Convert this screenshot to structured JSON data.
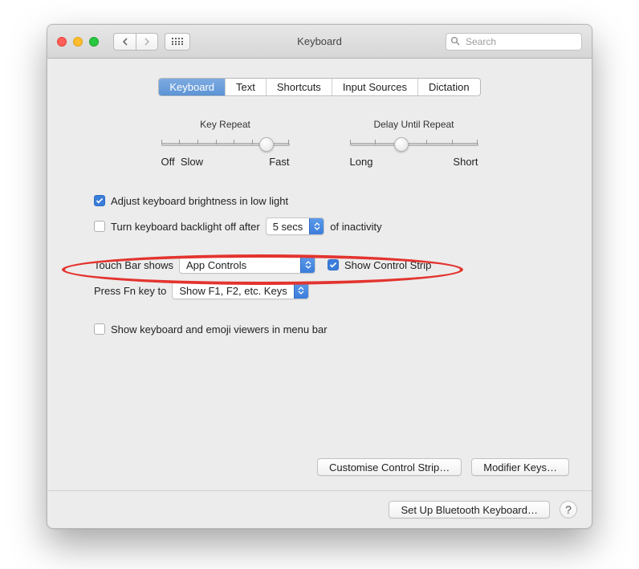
{
  "window": {
    "title": "Keyboard"
  },
  "search": {
    "placeholder": "Search"
  },
  "tabs": [
    "Keyboard",
    "Text",
    "Shortcuts",
    "Input Sources",
    "Dictation"
  ],
  "active_tab": 0,
  "sliders": {
    "key_repeat": {
      "title": "Key Repeat",
      "left": "Off",
      "left2": "Slow",
      "right": "Fast",
      "position": 0.82,
      "ticks": 8
    },
    "delay": {
      "title": "Delay Until Repeat",
      "left": "Long",
      "right": "Short",
      "position": 0.4,
      "ticks": 6
    }
  },
  "options": {
    "adjust_brightness": {
      "label": "Adjust keyboard brightness in low light",
      "checked": true
    },
    "backlight_off": {
      "label_pre": "Turn keyboard backlight off after",
      "value": "5 secs",
      "label_post": "of inactivity",
      "checked": false
    },
    "touchbar": {
      "label": "Touch Bar shows",
      "value": "App Controls"
    },
    "control_strip": {
      "label": "Show Control Strip",
      "checked": true
    },
    "fn_key": {
      "label": "Press Fn key to",
      "value": "Show F1, F2, etc. Keys"
    },
    "show_viewers": {
      "label": "Show keyboard and emoji viewers in menu bar",
      "checked": false
    }
  },
  "buttons": {
    "customise": "Customise Control Strip…",
    "modifier": "Modifier Keys…",
    "bluetooth": "Set Up Bluetooth Keyboard…",
    "help": "?"
  }
}
